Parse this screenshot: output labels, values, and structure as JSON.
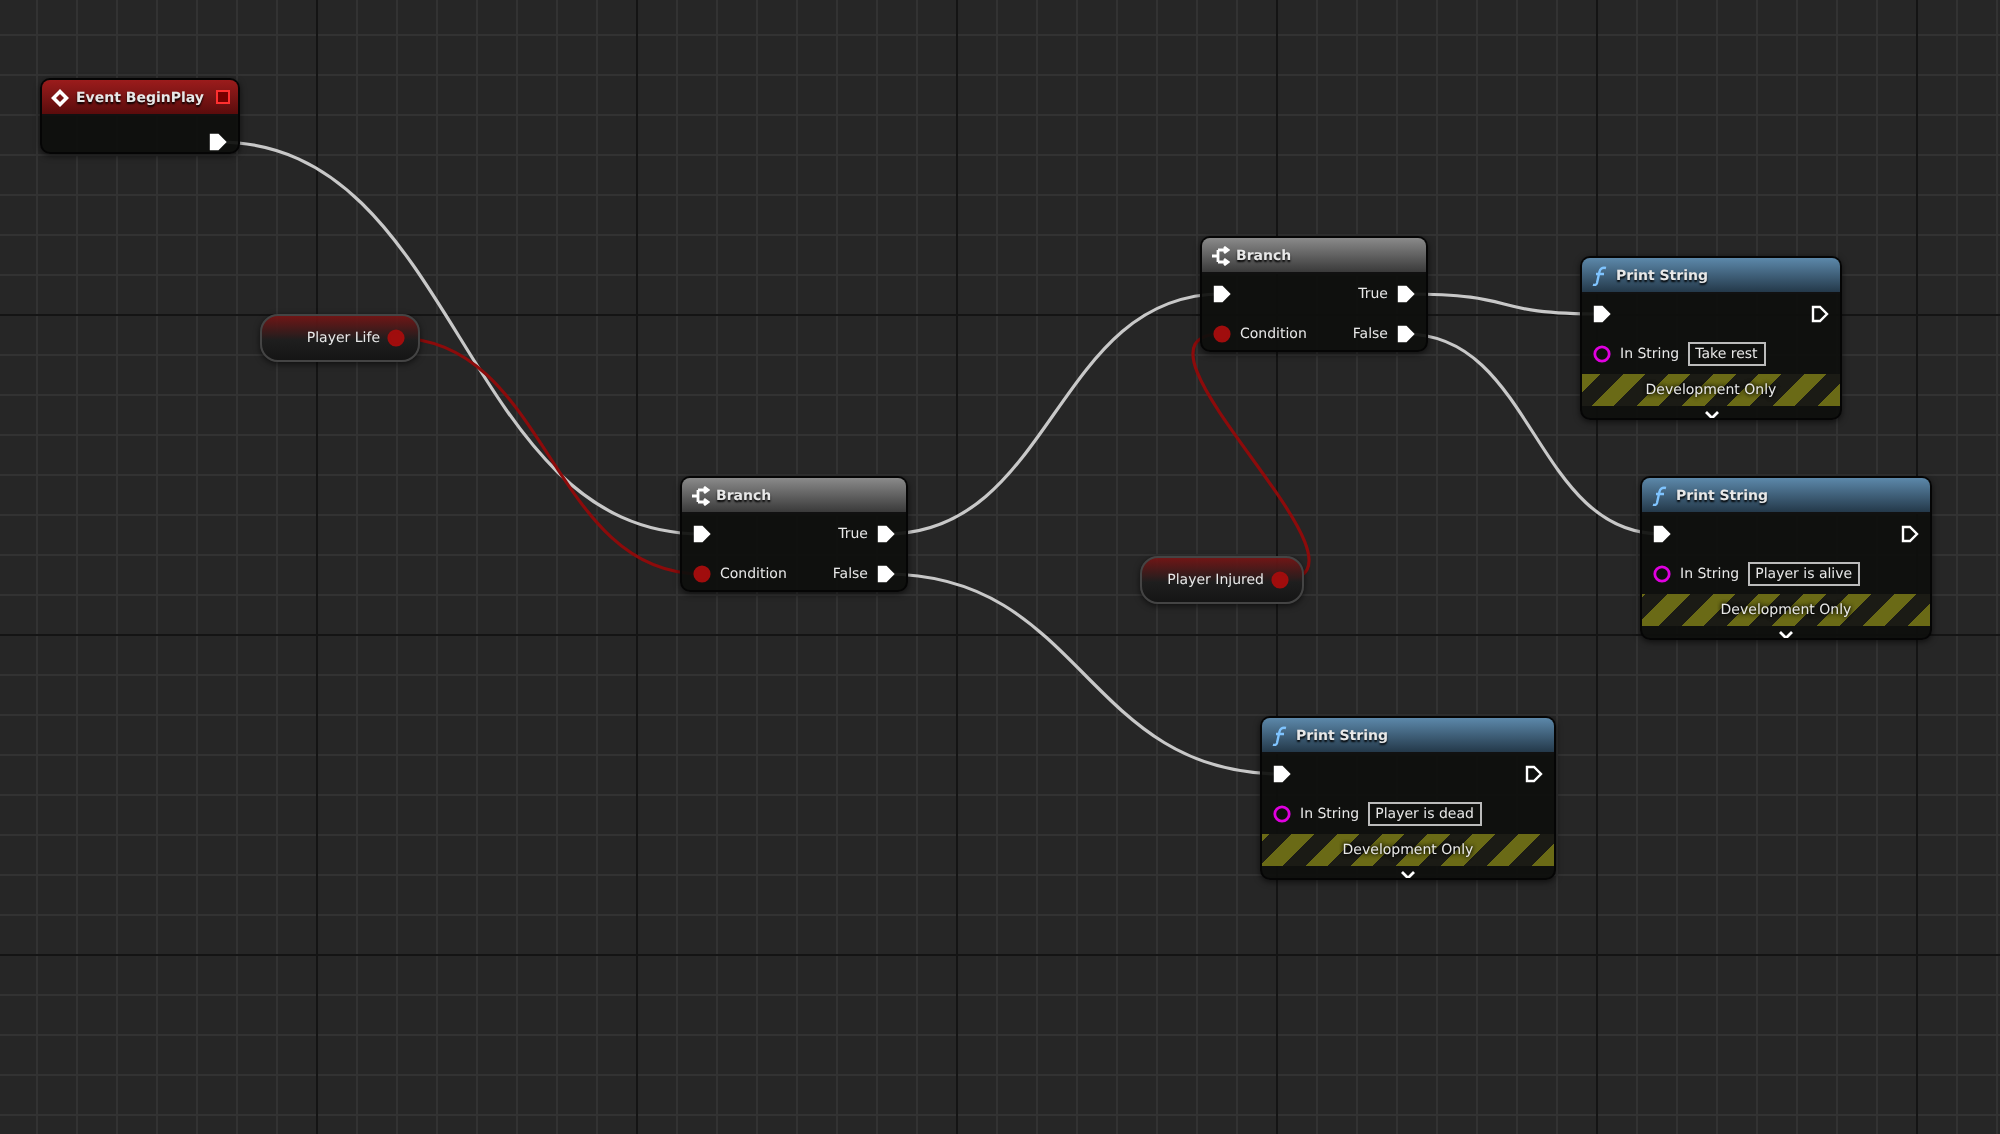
{
  "nodes": [
    {
      "kind": "event",
      "title": "Event BeginPlay",
      "outputs": [
        {
          "kind": "exec",
          "connected": true
        }
      ]
    },
    {
      "kind": "variable",
      "title": "Player Life",
      "outputs": [
        {
          "kind": "bool",
          "connected": true
        }
      ]
    },
    {
      "kind": "branch",
      "title": "Branch",
      "inputs": [
        {
          "kind": "exec",
          "connected": true
        },
        {
          "kind": "bool",
          "label": "Condition",
          "connected": true
        }
      ],
      "outputs": [
        {
          "kind": "exec",
          "label": "True",
          "connected": true
        },
        {
          "kind": "exec",
          "label": "False",
          "connected": true
        }
      ]
    },
    {
      "kind": "branch",
      "title": "Branch",
      "inputs": [
        {
          "kind": "exec",
          "connected": true
        },
        {
          "kind": "bool",
          "label": "Condition",
          "connected": true
        }
      ],
      "outputs": [
        {
          "kind": "exec",
          "label": "True",
          "connected": true
        },
        {
          "kind": "exec",
          "label": "False",
          "connected": true
        }
      ]
    },
    {
      "kind": "variable",
      "title": "Player Injured",
      "outputs": [
        {
          "kind": "bool",
          "connected": true
        }
      ]
    },
    {
      "kind": "print",
      "title": "Print String",
      "inputs": [
        {
          "kind": "exec",
          "connected": true
        },
        {
          "kind": "string",
          "label": "In String",
          "value": "Take rest",
          "connected": false
        }
      ],
      "outputs": [
        {
          "kind": "exec",
          "connected": false
        }
      ],
      "banner": "Development Only"
    },
    {
      "kind": "print",
      "title": "Print String",
      "inputs": [
        {
          "kind": "exec",
          "connected": true
        },
        {
          "kind": "string",
          "label": "In String",
          "value": "Player is alive",
          "connected": false
        }
      ],
      "outputs": [
        {
          "kind": "exec",
          "connected": false
        }
      ],
      "banner": "Development Only"
    },
    {
      "kind": "print",
      "title": "Print String",
      "inputs": [
        {
          "kind": "exec",
          "connected": true
        },
        {
          "kind": "string",
          "label": "In String",
          "value": "Player is dead",
          "connected": false
        }
      ],
      "outputs": [
        {
          "kind": "exec",
          "connected": false
        }
      ],
      "banner": "Development Only"
    }
  ],
  "wires": [
    {
      "kind": "exec"
    },
    {
      "kind": "bool"
    },
    {
      "kind": "exec"
    },
    {
      "kind": "exec"
    },
    {
      "kind": "bool"
    },
    {
      "kind": "exec"
    },
    {
      "kind": "exec"
    }
  ]
}
